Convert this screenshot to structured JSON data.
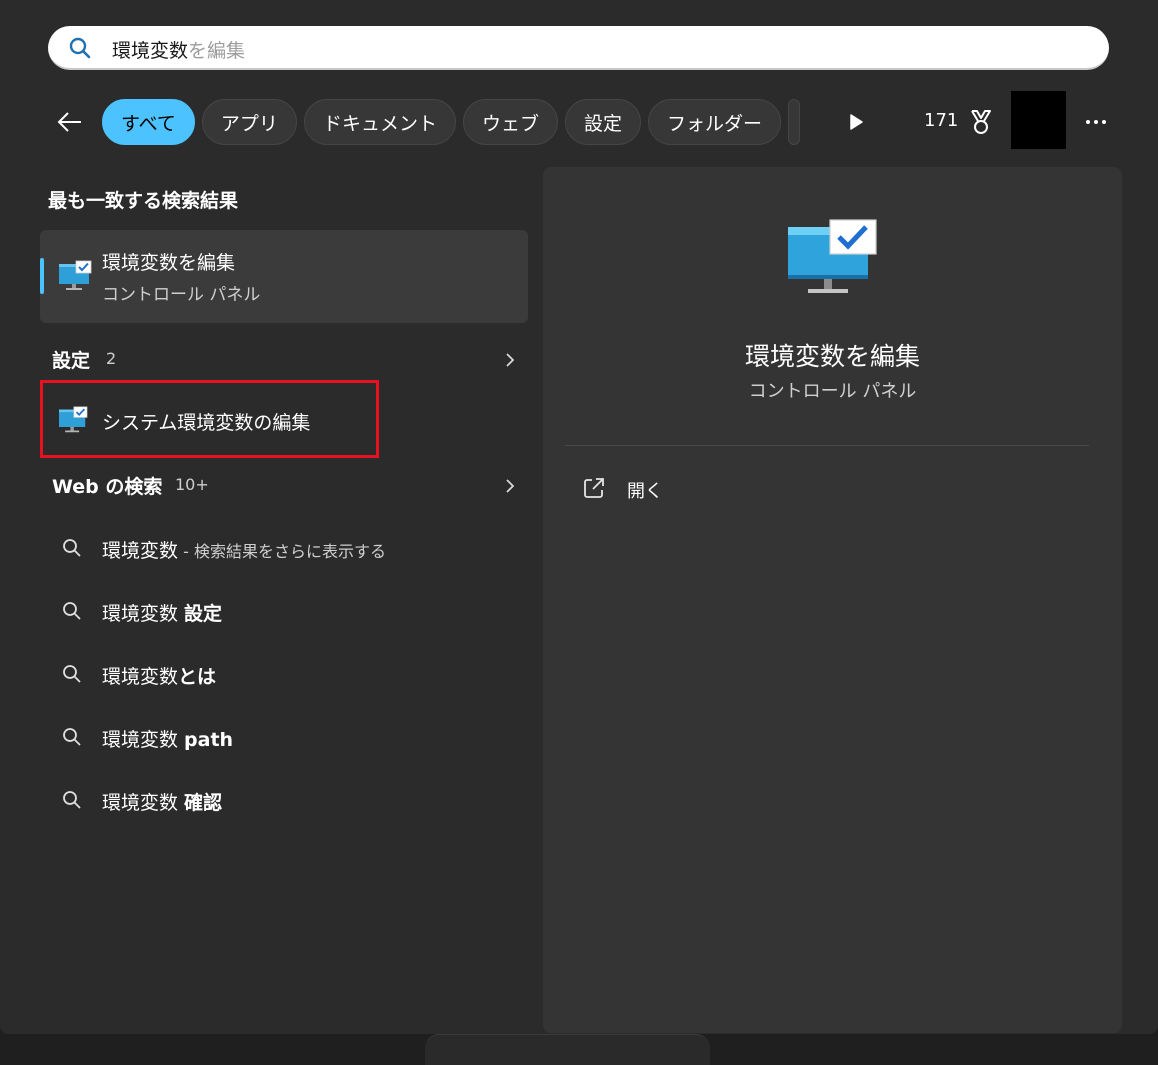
{
  "search": {
    "typed": "環境変数",
    "suggestion": "を編集"
  },
  "filters": {
    "items": [
      "すべて",
      "アプリ",
      "ドキュメント",
      "ウェブ",
      "設定",
      "フォルダー"
    ],
    "active": "すべて"
  },
  "header": {
    "points": "171"
  },
  "best_match": {
    "heading": "最も一致する検索結果",
    "title": "環境変数を編集",
    "subtitle": "コントロール パネル"
  },
  "settings_group": {
    "label": "設定",
    "count": "2",
    "items": [
      "システム環境変数の編集"
    ]
  },
  "web_group": {
    "label": "Web の検索",
    "count": "10+",
    "items": [
      {
        "main": "環境変数",
        "suffix": " - 検索結果をさらに表示する"
      },
      {
        "main": "環境変数 ",
        "bold": "設定"
      },
      {
        "main": "環境変数",
        "bold": "とは"
      },
      {
        "main": "環境変数 ",
        "bold": "path"
      },
      {
        "main": "環境変数 ",
        "bold": "確認"
      }
    ]
  },
  "detail": {
    "title": "環境変数を編集",
    "subtitle": "コントロール パネル",
    "action_open": "開く"
  },
  "colors": {
    "accent": "#4cc2ff",
    "highlight_box": "#e81123",
    "panel_bg": "#2b2b2b"
  }
}
